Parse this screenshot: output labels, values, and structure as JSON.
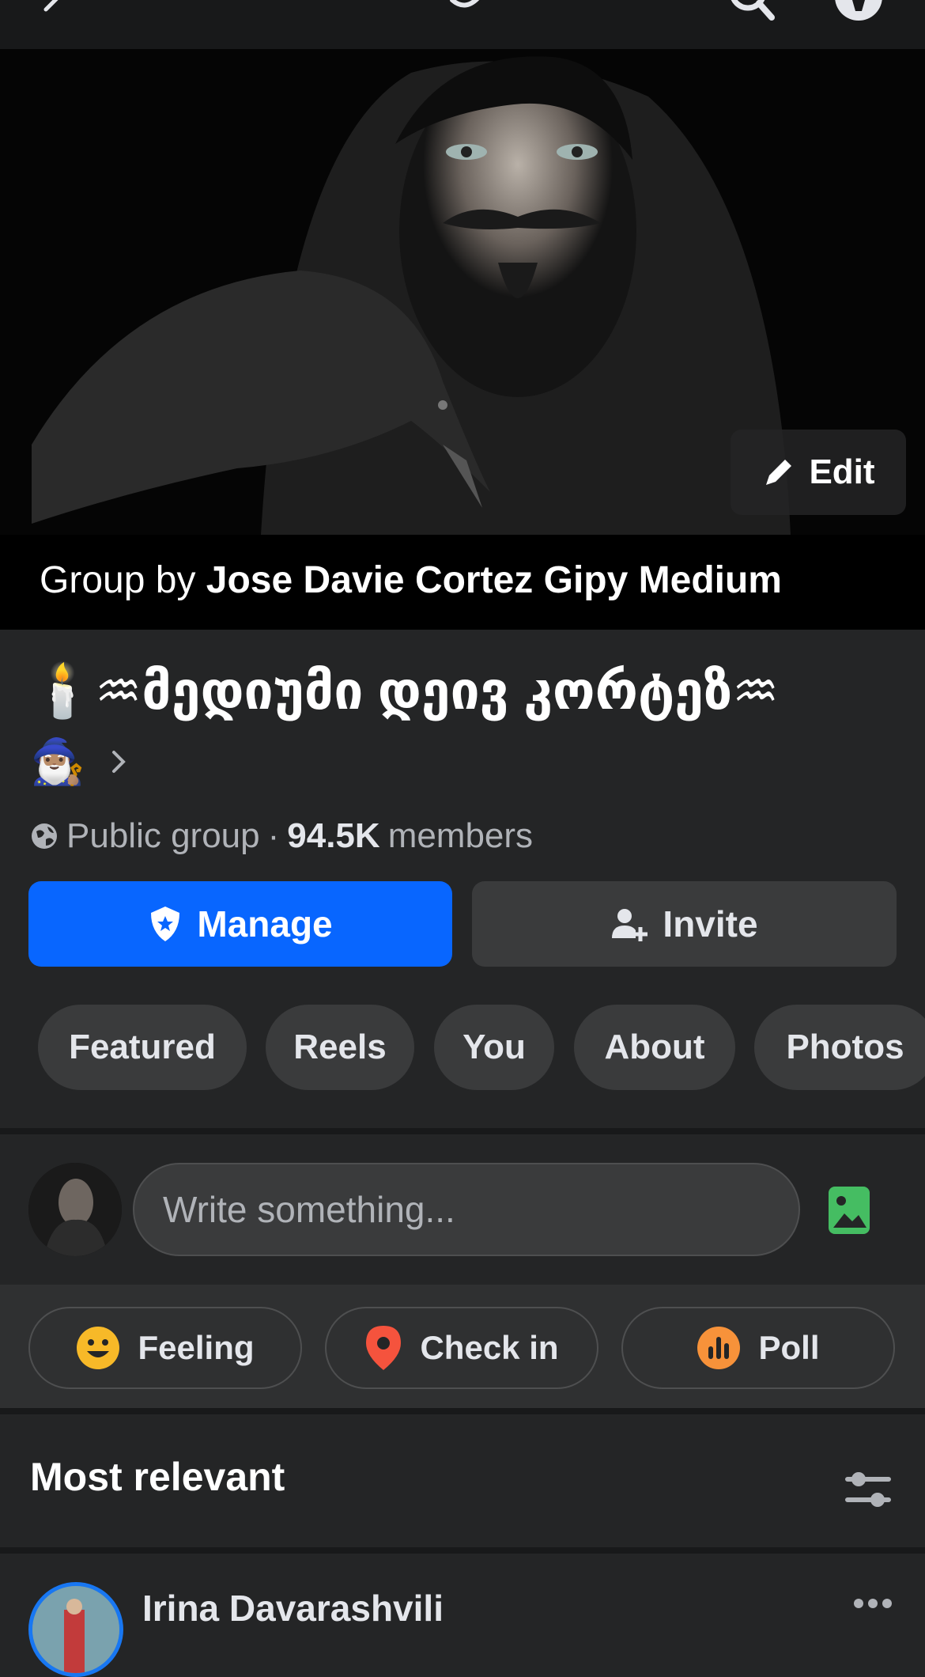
{
  "cover": {
    "edit_label": "Edit"
  },
  "group": {
    "by_prefix": "Group by",
    "owner": "Jose Davie Cortez Gipy Medium",
    "name": "🕯️♒მედიუმი დეივ კორტეზ♒",
    "name_emoji": "🧙🏽‍♂️",
    "privacy": "Public group",
    "separator": "·",
    "member_count": "94.5K",
    "members_label": "members"
  },
  "buttons": {
    "manage": "Manage",
    "invite": "Invite"
  },
  "tabs": [
    "Featured",
    "Reels",
    "You",
    "About",
    "Photos"
  ],
  "composer": {
    "placeholder": "Write something..."
  },
  "actions": [
    "Feeling",
    "Check in",
    "Poll"
  ],
  "feed": {
    "sort_label": "Most relevant"
  },
  "post": {
    "author": "Irina Davarashvili"
  },
  "colors": {
    "primary": "#0866ff",
    "background": "#242526",
    "surface": "#3a3b3c",
    "feeling": "#f7b928",
    "checkin": "#f5533d",
    "poll": "#f7923a",
    "photo": "#45bd62"
  }
}
